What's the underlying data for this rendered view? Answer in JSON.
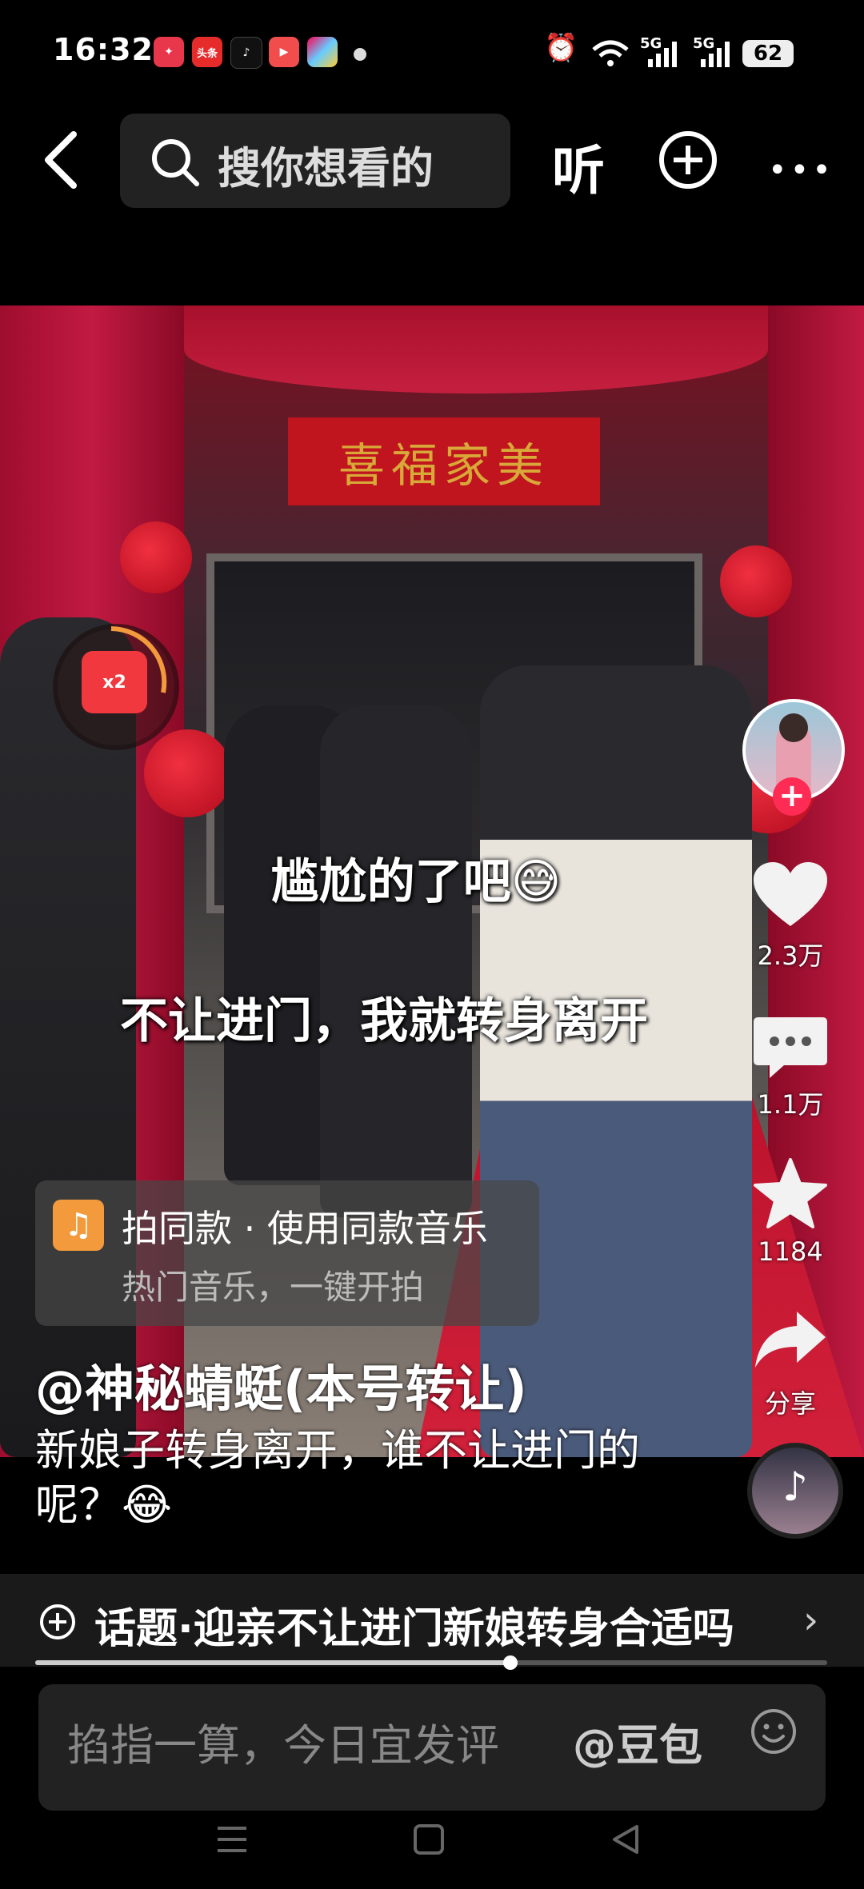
{
  "status_bar": {
    "time": "16:32",
    "apps": [
      {
        "name": "app-icon-1",
        "label": "",
        "color": "#e8364a"
      },
      {
        "name": "toutiao-icon",
        "label": "头条",
        "color": "#e62b2b"
      },
      {
        "name": "douyin-icon",
        "label": "",
        "color": "#111111"
      },
      {
        "name": "video-app-icon",
        "label": "",
        "color": "#f24d4d"
      },
      {
        "name": "gallery-app-icon",
        "label": "",
        "color": "#7a6cf0"
      }
    ],
    "signal_1": "5G",
    "signal_2": "5G",
    "battery": "62"
  },
  "top_nav": {
    "search_placeholder": "搜你想看的",
    "listen_label": "听"
  },
  "video": {
    "banner_text": "喜福家美",
    "overlay_line_1": "尴尬的了吧😅",
    "overlay_line_2": "不让进门，我就转身离开",
    "red_packet_label": "x2"
  },
  "right_rail": {
    "likes": "2.3万",
    "comments": "1.1万",
    "favorites": "1184",
    "share": "分享"
  },
  "music": {
    "title": "拍同款 · 使用同款音乐",
    "subtitle": "热门音乐，一键开拍"
  },
  "caption": {
    "author": "@神秘蜻蜓(本号转让)",
    "text": "新娘子转身离开，谁不让进门的呢？😂"
  },
  "topic": {
    "text": "话题·迎亲不让进门新娘转身合适吗",
    "progress": 0.6
  },
  "comment_bar": {
    "placeholder": "掐指一算，今日宜发评",
    "at_label": "@豆包"
  },
  "colors": {
    "accent": "#fe2c55",
    "music_badge": "#f39a3c",
    "red_packet": "#f0383e"
  }
}
